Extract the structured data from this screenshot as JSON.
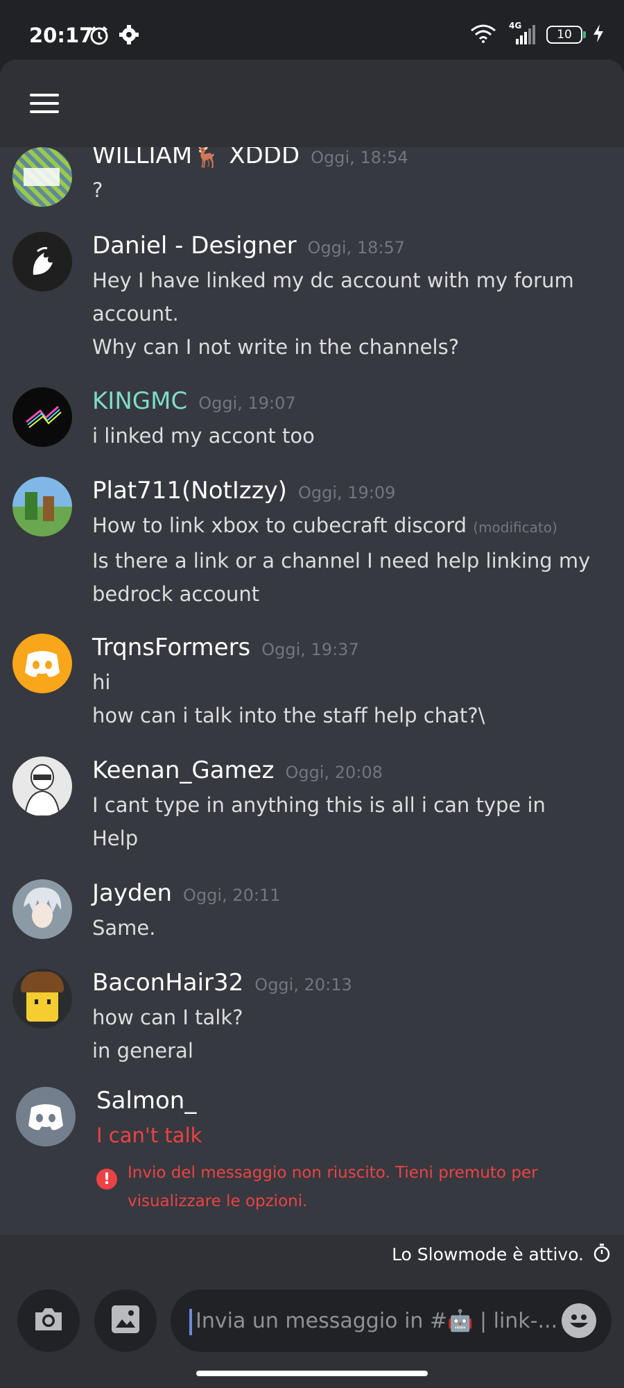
{
  "status_bar": {
    "time": "20:17",
    "network": "4G",
    "battery": "10",
    "icons": [
      "alarm-icon",
      "settings-gear-icon",
      "wifi-icon",
      "signal-icon",
      "battery-icon",
      "charging-bolt-icon"
    ]
  },
  "header": {
    "menu_icon": "hamburger-menu-icon"
  },
  "messages": [
    {
      "username": "WILLIAM",
      "username_emoji": "🦌",
      "username_suffix": "XDDD",
      "timestamp": "Oggi, 18:54",
      "lines": [
        "?"
      ]
    },
    {
      "username": "Daniel - Designer",
      "timestamp": "Oggi, 18:57",
      "lines": [
        "Hey I have linked my dc account with my forum",
        "account.",
        "Why can I not write in the channels?"
      ]
    },
    {
      "username": "KINGMC",
      "username_color": "#7fdbca",
      "timestamp": "Oggi, 19:07",
      "lines": [
        "i linked my accont too"
      ]
    },
    {
      "username": "Plat711(NotIzzy)",
      "timestamp": "Oggi, 19:09",
      "lines": [
        "How to link xbox to cubecraft discord",
        "Is there a link or a channel I need help linking my",
        "bedrock account"
      ],
      "edited_label": "(modificato)"
    },
    {
      "username": "TrqnsFormers",
      "timestamp": "Oggi, 19:37",
      "lines": [
        "hi",
        "how can i talk into the staff help chat?\\"
      ]
    },
    {
      "username": "Keenan_Gamez",
      "timestamp": "Oggi, 20:08",
      "lines": [
        "I cant type in anything this is all i can type in",
        "Help"
      ]
    },
    {
      "username": "Jayden",
      "timestamp": "Oggi, 20:11",
      "lines": [
        "Same."
      ]
    },
    {
      "username": "BaconHair32",
      "timestamp": "Oggi, 20:13",
      "lines": [
        "how can I talk?",
        "in general"
      ]
    },
    {
      "username": "Salmon_",
      "lines": [
        "I can't talk"
      ],
      "error_lines": [
        "Invio del messaggio non riuscito. Tieni premuto per",
        "visualizzare le opzioni."
      ]
    }
  ],
  "slowmode": {
    "label": "Lo Slowmode è attivo.",
    "icon": "stopwatch-icon"
  },
  "composer": {
    "placeholder": "Invia un messaggio in #🤖 | link-...",
    "camera_icon": "camera-icon",
    "gallery_icon": "image-gallery-icon",
    "emoji_icon": "emoji-icon"
  },
  "colors": {
    "background": "#36393f",
    "header": "#2f3136",
    "username": "#ffffff",
    "timestamp": "#72767d",
    "error": "#ed4245",
    "discord_yellow": "#faa61a",
    "discord_grey": "#747f8d"
  }
}
